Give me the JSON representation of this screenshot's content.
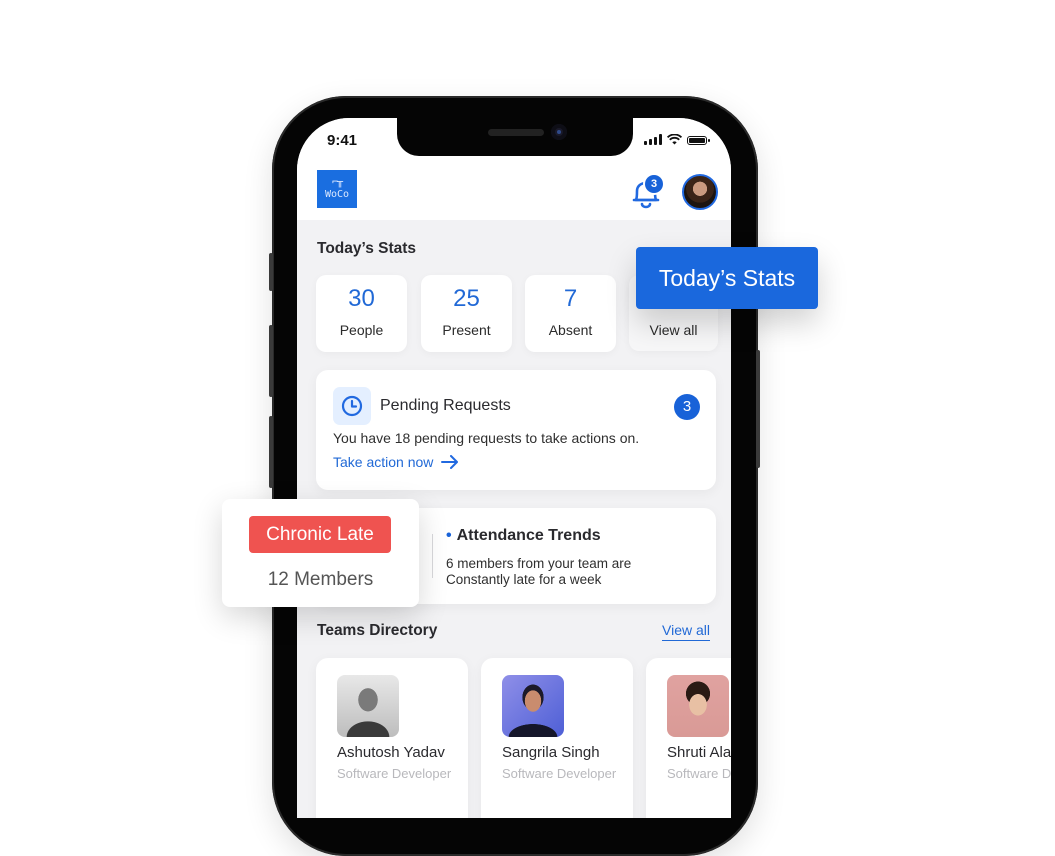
{
  "status_bar": {
    "time": "9:41"
  },
  "app": {
    "logo_text": "WoCo",
    "notification_count": "3",
    "brand_color": "#1a6ee0"
  },
  "todays_stats": {
    "title": "Today’s Stats",
    "items": [
      {
        "value": "30",
        "label": "People"
      },
      {
        "value": "25",
        "label": "Present"
      },
      {
        "value": "7",
        "label": "Absent"
      }
    ],
    "view_all_label": "View all"
  },
  "pending_requests": {
    "title": "Pending Requests",
    "badge": "3",
    "description": "You have 18 pending requests to take actions on.",
    "action_label": "Take action now"
  },
  "attendance_trends": {
    "title": "Attendance Trends",
    "description_line1": "6 members from your team are",
    "description_line2": "Constantly late for a week"
  },
  "teams_directory": {
    "title": "Teams Directory",
    "view_all_label": "View all",
    "members": [
      {
        "name": "Ashutosh Yadav",
        "role": "Software Developer"
      },
      {
        "name": "Sangrila Singh",
        "role": "Software Developer"
      },
      {
        "name": "Shruti Alam",
        "role": "Software Developer"
      }
    ]
  },
  "callouts": {
    "stats_label": "Today’s Stats",
    "chronic_late_label": "Chronic Late",
    "chronic_late_count": "12 Members",
    "chronic_late_color": "#ef5350"
  }
}
